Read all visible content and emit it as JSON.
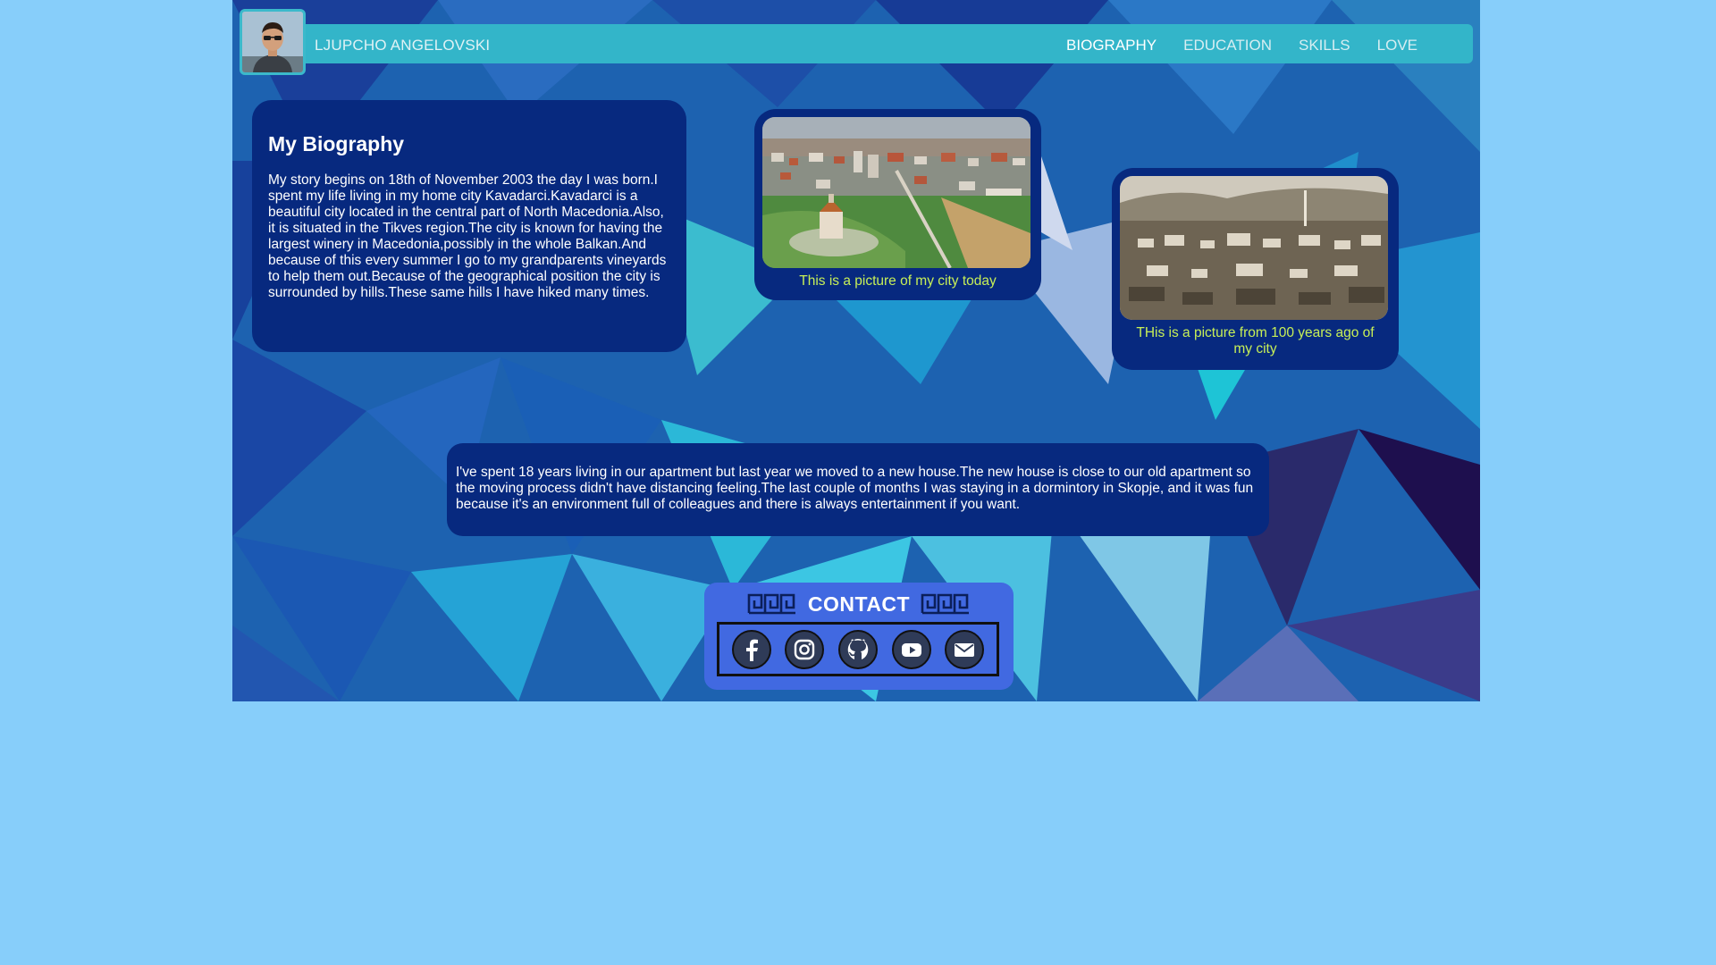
{
  "header": {
    "site_name": "LJUPCHO ANGELOVSKI",
    "nav": [
      {
        "label": "BIOGRAPHY",
        "active": true
      },
      {
        "label": "EDUCATION",
        "active": false
      },
      {
        "label": "SKILLS",
        "active": false
      },
      {
        "label": "LOVE",
        "active": false
      }
    ]
  },
  "biography": {
    "title": "My Biography",
    "text": "My story begins on 18th of November 2003 the day I was born.I spent my life living in my home city Kavadarci.Kavadarci is a beautiful city located in the central part of North Macedonia.Also, it is situated in the Tikves region.The city is known for having the largest winery in Macedonia,possibly in the whole Balkan.And because of this every summer I go to my grandparents vineyards to help them out.Because of the geographical position the city is surrounded by hills.These same hills I have hiked many times."
  },
  "photos": {
    "today_caption": "This is a picture of my city today",
    "old_caption": "THis is a picture from 100 years ago of my city"
  },
  "story": {
    "text": "I've spent 18 years living in our apartment but last year we moved to a new house.The new house is close to our old apartment so the moving process didn't have distancing feeling.The last couple of months I was staying in a dormintory in Skopje, and it was fun because it's an environment full of colleagues and there is always entertainment if you want."
  },
  "contact": {
    "title": "CONTACT",
    "icons": [
      "facebook-icon",
      "instagram-icon",
      "github-icon",
      "youtube-icon",
      "email-icon"
    ]
  },
  "colors": {
    "page_bg": "#87cefa",
    "navbar": "#33b5c9",
    "card": "#07297f",
    "caption": "#c7ef57",
    "contact_bg": "#4169e1"
  }
}
